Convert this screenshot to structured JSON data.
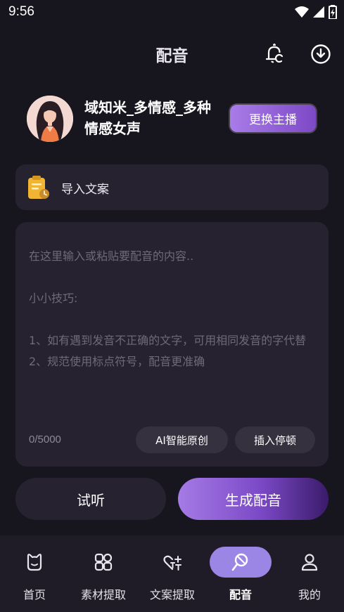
{
  "status_bar": {
    "time": "9:56",
    "icons": [
      "wifi-icon",
      "signal-icon",
      "battery-icon"
    ]
  },
  "header": {
    "title": "配音",
    "icons": [
      "bell-icon",
      "download-icon"
    ]
  },
  "voice": {
    "name": "域知米_多情感_多种情感女声",
    "switch_label": "更换主播"
  },
  "import": {
    "label": "导入文案"
  },
  "editor": {
    "placeholder": "在这里输入或粘贴要配音的内容..\n\n小小技巧:\n\n1、如有遇到发音不正确的文字，可用相同发音的字代替\n2、规范使用标点符号，配音更准确",
    "char_count": "0/5000",
    "ai_label": "AI智能原创",
    "pause_label": "插入停顿"
  },
  "actions": {
    "preview_label": "试听",
    "generate_label": "生成配音"
  },
  "nav": {
    "items": [
      {
        "label": "首页",
        "icon": "home-icon"
      },
      {
        "label": "素材提取",
        "icon": "material-icon"
      },
      {
        "label": "文案提取",
        "icon": "text-extract-icon"
      },
      {
        "label": "配音",
        "icon": "dubbing-icon",
        "active": true
      },
      {
        "label": "我的",
        "icon": "profile-icon"
      }
    ]
  },
  "colors": {
    "background": "#17151d",
    "card": "#26222f",
    "accent": "#9b86e6",
    "gradient_start": "#a57be6",
    "gradient_end": "#3a1b6a"
  }
}
